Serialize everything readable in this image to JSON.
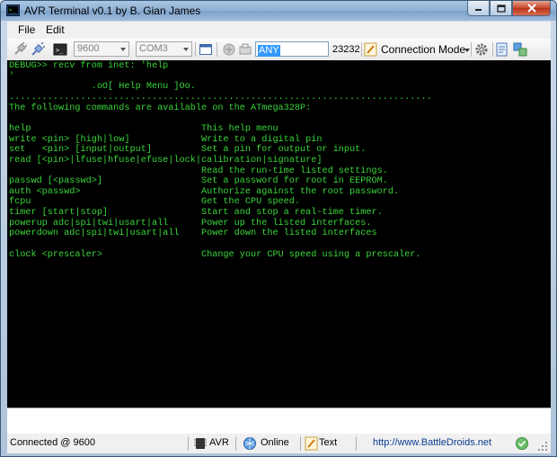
{
  "window": {
    "title": "AVR Terminal v0.1 by B. Gian James"
  },
  "menu": {
    "items": [
      "File",
      "Edit"
    ]
  },
  "toolbar": {
    "baud": "9600",
    "port": "COM3",
    "host_value": "ANY",
    "port_number": "23232",
    "connection_mode_label": "Connection Mode"
  },
  "terminal": {
    "lines": [
      "DEBUG>> recv from inet: 'help",
      "'",
      "               .oO[ Help Menu ]Oo.",
      ".............................................................................",
      "The following commands are available on the ATmega328P:",
      "",
      "help                               This help menu",
      "write <pin> [high|low]             Write to a digital pin",
      "set   <pin> [input|output]         Set a pin for output or input.",
      "read [<pin>|lfuse|hfuse|efuse|lock|calibration|signature]",
      "                                   Read the run-time listed settings.",
      "passwd [<passwd>]                  Set a password for root in EEPROM.",
      "auth <passwd>                      Authorize against the root password.",
      "fcpu                               Get the CPU speed.",
      "timer [start|stop]                 Start and stop a real-time timer.",
      "powerup adc|spi|twi|usart|all      Power up the listed interfaces.",
      "powerdown adc|spi|twi|usart|all    Power down the listed interfaces",
      "",
      "clock <prescaler>                  Change your CPU speed using a prescaler."
    ],
    "text_color": "#39d639",
    "background": "#000000"
  },
  "statusbar": {
    "connection": "Connected @ 9600",
    "device": "AVR",
    "online": "Online",
    "mode": "Text",
    "url": "http://www.BattleDroids.net"
  }
}
